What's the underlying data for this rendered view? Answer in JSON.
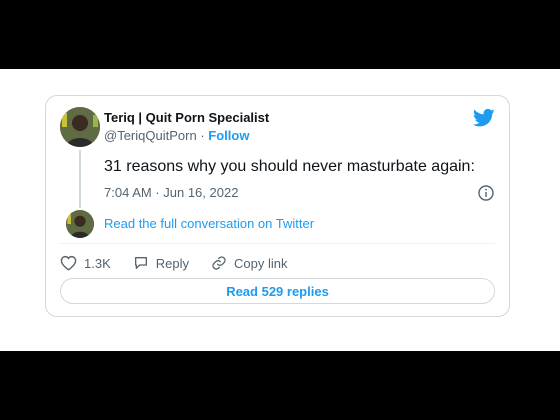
{
  "author": {
    "name": "Teriq | Quit Porn Specialist",
    "handle": "@TeriqQuitPorn",
    "separator": "·",
    "follow_label": "Follow"
  },
  "tweet": {
    "text": "31 reasons why you should never masturbate again:",
    "timestamp": "7:04 AM · Jun 16, 2022"
  },
  "thread": {
    "link_label": "Read the full conversation on Twitter"
  },
  "actions": {
    "like_count": "1.3K",
    "reply_label": "Reply",
    "copy_label": "Copy link"
  },
  "replies_button": {
    "label": "Read 529 replies"
  },
  "icons": {
    "brand": "twitter-bird-icon",
    "info": "info-icon",
    "like": "heart-icon",
    "reply": "speech-bubble-icon",
    "copy": "link-icon"
  },
  "colors": {
    "accent": "#1d9bf0",
    "text": "#0f1419",
    "muted": "#536471",
    "border": "#cfd9de"
  }
}
